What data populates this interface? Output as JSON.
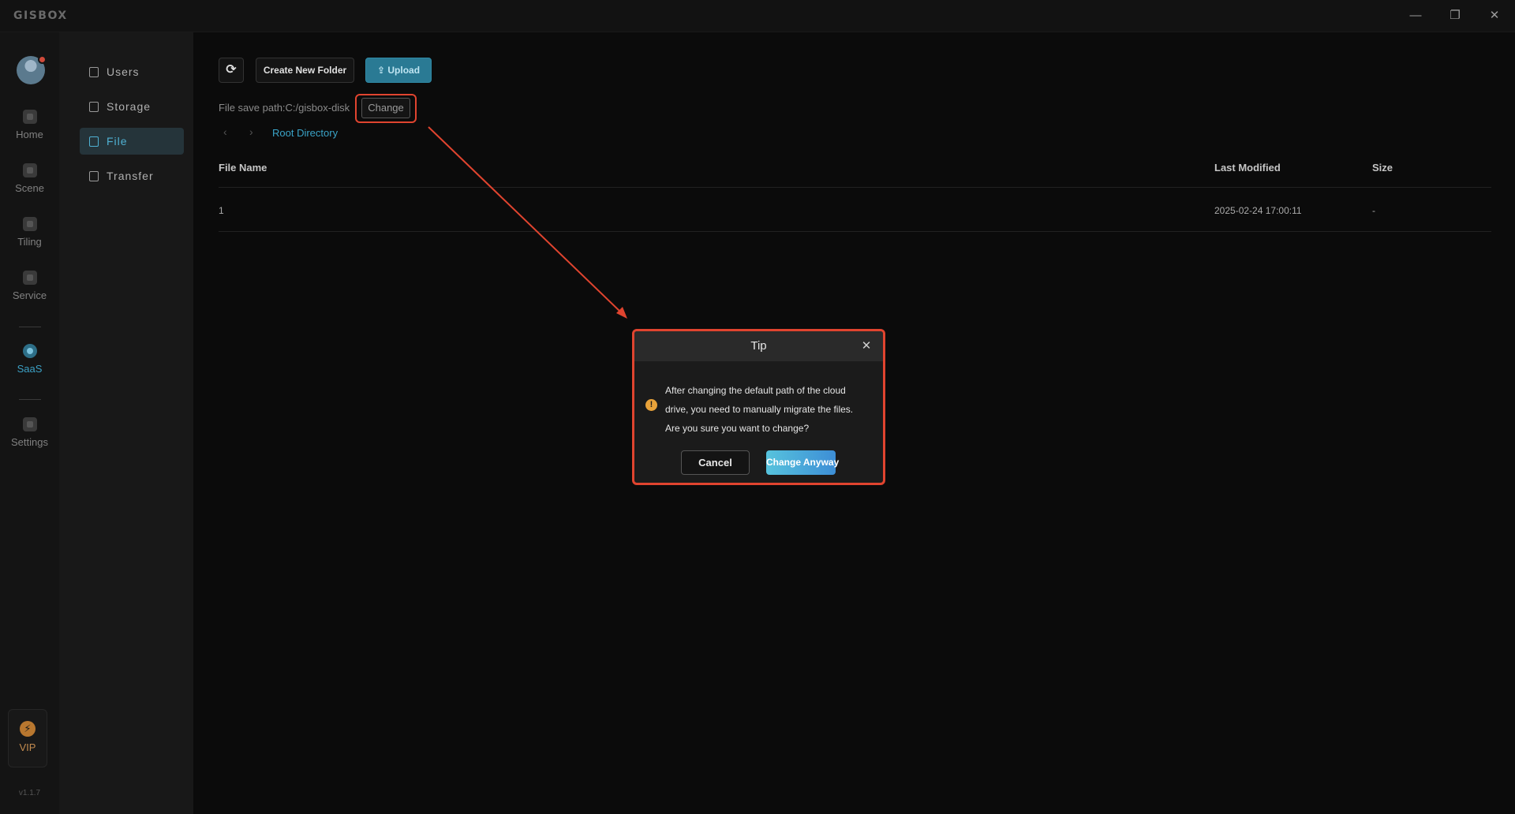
{
  "app": {
    "brand": "GISBOX"
  },
  "window_controls": {
    "minimize": "—",
    "restore": "❐",
    "close": "✕"
  },
  "rail": {
    "items": [
      {
        "label": "Home",
        "icon": "home-icon"
      },
      {
        "label": "Scene",
        "icon": "cube-icon"
      },
      {
        "label": "Tiling",
        "icon": "tiling-icon"
      },
      {
        "label": "Service",
        "icon": "service-icon"
      },
      {
        "label": "SaaS",
        "icon": "saas-icon",
        "active": true
      },
      {
        "label": "Settings",
        "icon": "settings-icon"
      }
    ],
    "vip": {
      "label": "VIP",
      "icon_glyph": "⚡"
    },
    "version": "v1.1.7"
  },
  "subnav": {
    "items": [
      {
        "label": "Users",
        "icon": "user-icon"
      },
      {
        "label": "Storage",
        "icon": "storage-icon"
      },
      {
        "label": "File",
        "icon": "file-icon",
        "active": true
      },
      {
        "label": "Transfer",
        "icon": "transfer-icon"
      }
    ]
  },
  "toolbar": {
    "refresh_glyph": "⟳",
    "create_folder": "Create New Folder",
    "upload": "Upload",
    "upload_glyph": "⇪"
  },
  "path": {
    "label": "File save path:C:/gisbox-disk",
    "change": "Change"
  },
  "breadcrumb": {
    "back": "‹",
    "forward": "›",
    "root": "Root Directory"
  },
  "table": {
    "headers": {
      "name": "File Name",
      "modified": "Last Modified",
      "size": "Size"
    },
    "rows": [
      {
        "name": "1",
        "modified": "2025-02-24 17:00:11",
        "size": "-"
      }
    ]
  },
  "modal": {
    "title": "Tip",
    "close_glyph": "✕",
    "warn_glyph": "!",
    "message_lines": [
      "After changing the default path of the cloud",
      "drive, you need to manually migrate the files.",
      "Are you sure you want to change?"
    ],
    "cancel": "Cancel",
    "confirm": "Change Anyway"
  },
  "colors": {
    "accent": "#3aa3c7",
    "highlight_red": "#e0442f",
    "warning": "#e8a23a"
  }
}
